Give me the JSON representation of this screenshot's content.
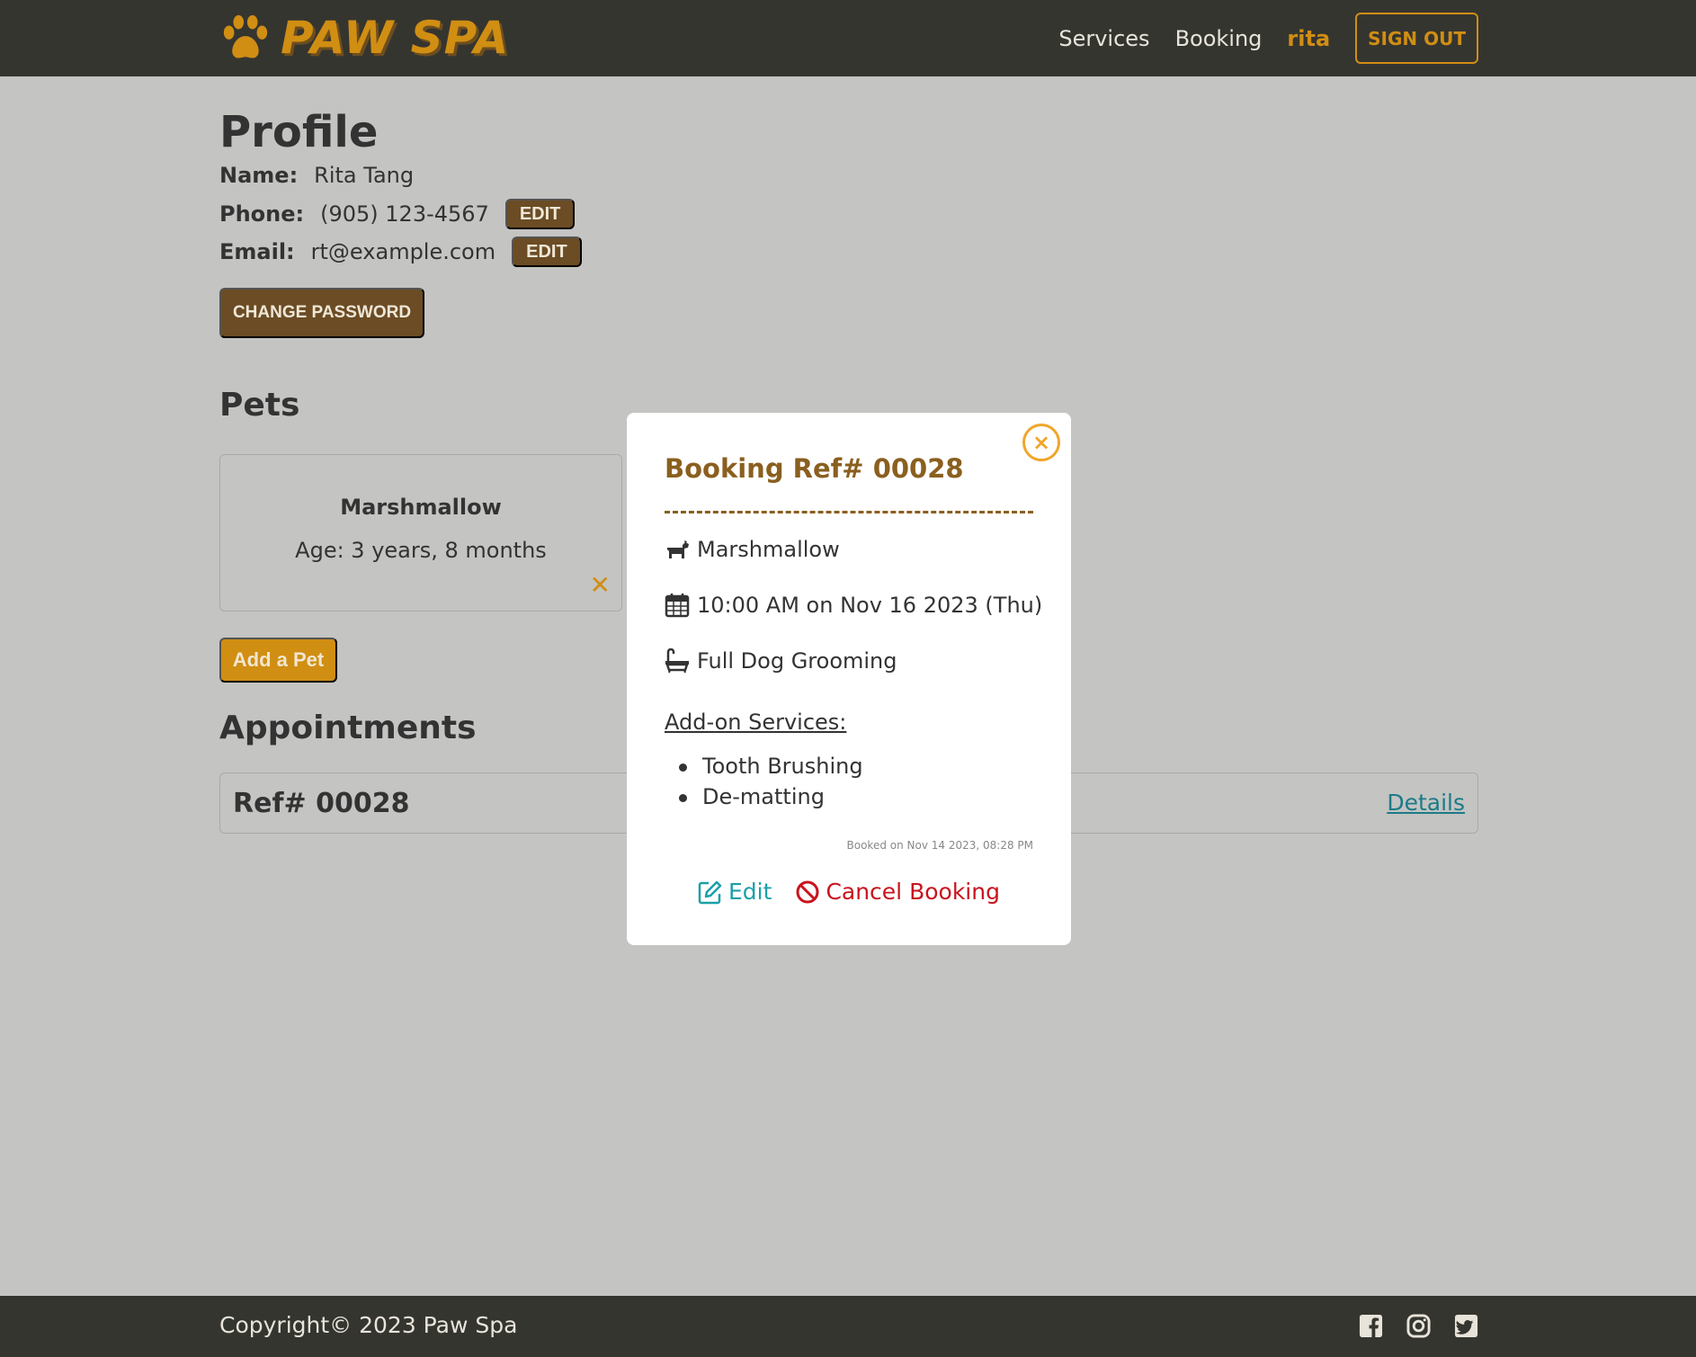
{
  "brand": {
    "name": "PAW SPA",
    "accent": "#d08e13",
    "dark": "#353530",
    "brown": "#6b4c24"
  },
  "nav": {
    "services": "Services",
    "booking": "Booking",
    "user": "rita",
    "sign_out": "SIGN OUT"
  },
  "profile": {
    "title": "Profile",
    "name_label": "Name:",
    "name_value": "Rita Tang",
    "phone_label": "Phone:",
    "phone_value": "(905) 123-4567",
    "phone_edit": "EDIT",
    "email_label": "Email:",
    "email_value": "rt@example.com",
    "email_edit": "EDIT",
    "change_password": "CHANGE PASSWORD"
  },
  "pets": {
    "title": "Pets",
    "items": [
      {
        "name": "Marshmallow",
        "age": "Age: 3 years, 8 months",
        "remove": "✕"
      }
    ],
    "add_button": "Add a Pet"
  },
  "appointments": {
    "title": "Appointments",
    "items": [
      {
        "ref": "Ref# 00028",
        "details": "Details"
      }
    ]
  },
  "modal": {
    "title": "Booking Ref# 00028",
    "close": "×",
    "pet": "Marshmallow",
    "datetime": "10:00 AM on Nov 16 2023 (Thu)",
    "service": "Full Dog Grooming",
    "addons_heading": "Add-on Services:",
    "addons": [
      "Tooth Brushing",
      "De-matting"
    ],
    "booked_on": "Booked on Nov 14 2023, 08:28 PM",
    "edit": "Edit",
    "cancel": "Cancel Booking"
  },
  "footer": {
    "copyright": "Copyright© 2023 Paw Spa",
    "social": [
      "facebook-icon",
      "instagram-icon",
      "twitter-icon"
    ]
  }
}
